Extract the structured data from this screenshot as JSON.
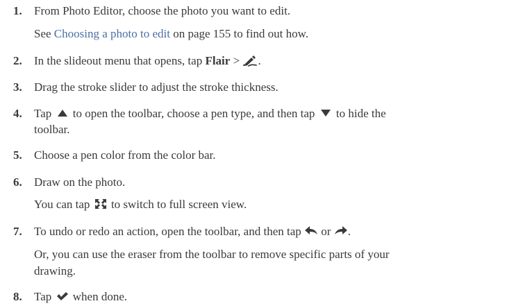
{
  "steps": [
    {
      "number": "1.",
      "text": "From Photo Editor, choose the photo you want to edit.",
      "sub_before": "See ",
      "sub_link": "Choosing a photo to edit",
      "sub_after": " on page 155 to find out how."
    },
    {
      "number": "2.",
      "before": "In the slideout menu that opens, tap ",
      "bold": "Flair",
      "after_bold": " > ",
      "icon": "pen-draw-icon",
      "end": "."
    },
    {
      "number": "3.",
      "text": "Drag the stroke slider to adjust the stroke thickness."
    },
    {
      "number": "4.",
      "part1": "Tap ",
      "icon1": "triangle-up-icon",
      "part2": " to open the toolbar, choose a pen type, and then tap ",
      "icon2": "triangle-down-icon",
      "part3": " to hide the",
      "line2": "toolbar."
    },
    {
      "number": "5.",
      "text": "Choose a pen color from the color bar."
    },
    {
      "number": "6.",
      "text": "Draw on the photo.",
      "sub_before": "You can tap ",
      "sub_icon": "fullscreen-icon",
      "sub_after": " to switch to full screen view."
    },
    {
      "number": "7.",
      "before": "To undo or redo an action, open the toolbar, and then tap ",
      "icon1": "undo-icon",
      "middle": " or ",
      "icon2": "redo-icon",
      "end": ".",
      "sub_line1": "Or, you can use the eraser from the toolbar to remove specific parts of your",
      "sub_line2": "drawing."
    },
    {
      "number": "8.",
      "before": "Tap ",
      "icon": "checkmark-icon",
      "after": " when done."
    }
  ],
  "colors": {
    "text": "#3a3a3a",
    "link": "#4a6fa5"
  }
}
